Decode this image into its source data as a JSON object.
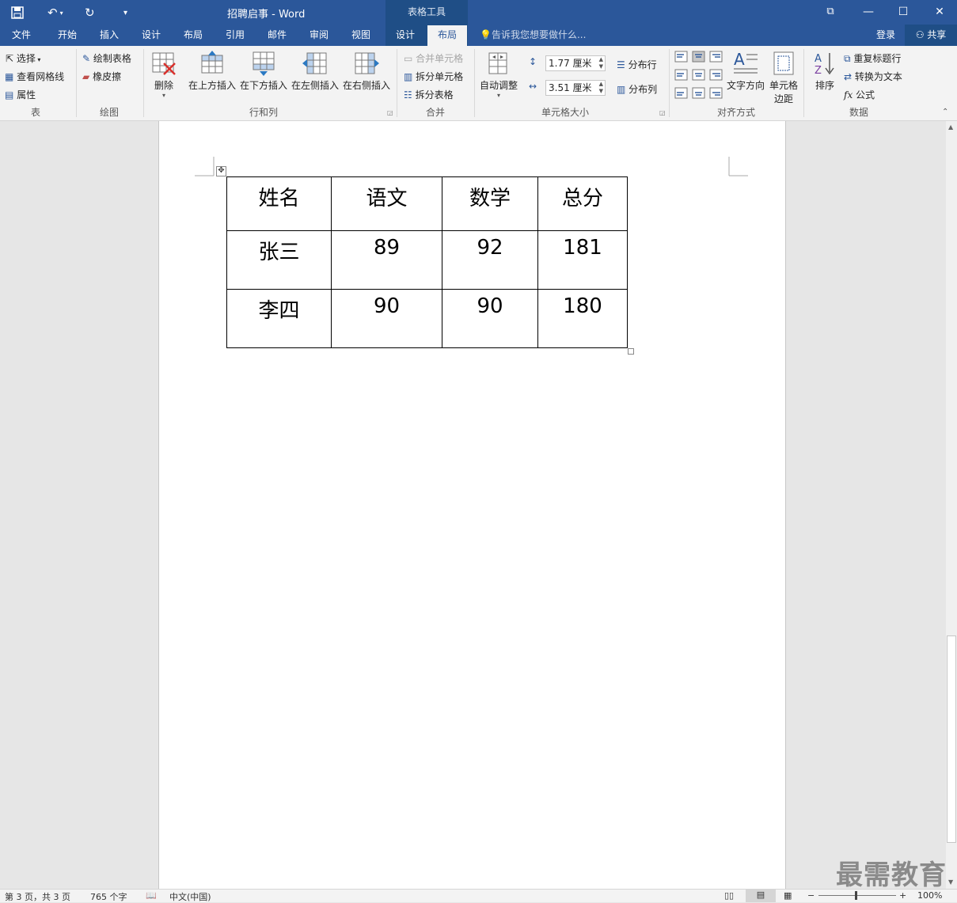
{
  "window": {
    "title": "招聘启事 - Word",
    "context_header": "表格工具",
    "login": "登录",
    "share": "共享",
    "min_glyph": "—",
    "max_glyph": "☐",
    "close_glyph": "✕",
    "ribbon_opts_glyph": "⧉"
  },
  "tabs": [
    {
      "label": "文件"
    },
    {
      "label": "开始"
    },
    {
      "label": "插入"
    },
    {
      "label": "设计"
    },
    {
      "label": "布局"
    },
    {
      "label": "引用"
    },
    {
      "label": "邮件"
    },
    {
      "label": "审阅"
    },
    {
      "label": "视图"
    },
    {
      "label": "设计"
    },
    {
      "label": "布局"
    }
  ],
  "tell_me": "告诉我您想要做什么...",
  "ribbon": {
    "table": {
      "select": "选择",
      "view_gridlines": "查看网格线",
      "properties": "属性",
      "group": "表"
    },
    "draw": {
      "draw_table": "绘制表格",
      "eraser": "橡皮擦",
      "group": "绘图"
    },
    "rows_cols": {
      "delete": "删除",
      "insert_above": "在上方插入",
      "insert_below": "在下方插入",
      "insert_left": "在左侧插入",
      "insert_right": "在右侧插入",
      "group": "行和列"
    },
    "merge": {
      "merge_cells": "合并单元格",
      "split_cells": "拆分单元格",
      "split_table": "拆分表格",
      "group": "合并"
    },
    "cell_size": {
      "autofit": "自动调整",
      "height": "1.77 厘米",
      "width": "3.51 厘米",
      "distribute_rows": "分布行",
      "distribute_cols": "分布列",
      "group": "单元格大小"
    },
    "alignment": {
      "text_direction": "文字方向",
      "cell_margins_1": "单元格",
      "cell_margins_2": "边距",
      "group": "对齐方式"
    },
    "data": {
      "sort": "排序",
      "repeat_header": "重复标题行",
      "convert_to_text": "转换为文本",
      "formula": "公式",
      "group": "数据"
    }
  },
  "table": {
    "header": [
      "姓名",
      "语文",
      "数学",
      "总分"
    ],
    "rows": [
      [
        "张三",
        "89",
        "92",
        "181"
      ],
      [
        "李四",
        "90",
        "90",
        "180"
      ]
    ]
  },
  "status": {
    "page": "第 3 页，共 3 页",
    "words": "765 个字",
    "language": "中文(中国)",
    "zoom": "100%"
  },
  "watermark": "最需教育"
}
